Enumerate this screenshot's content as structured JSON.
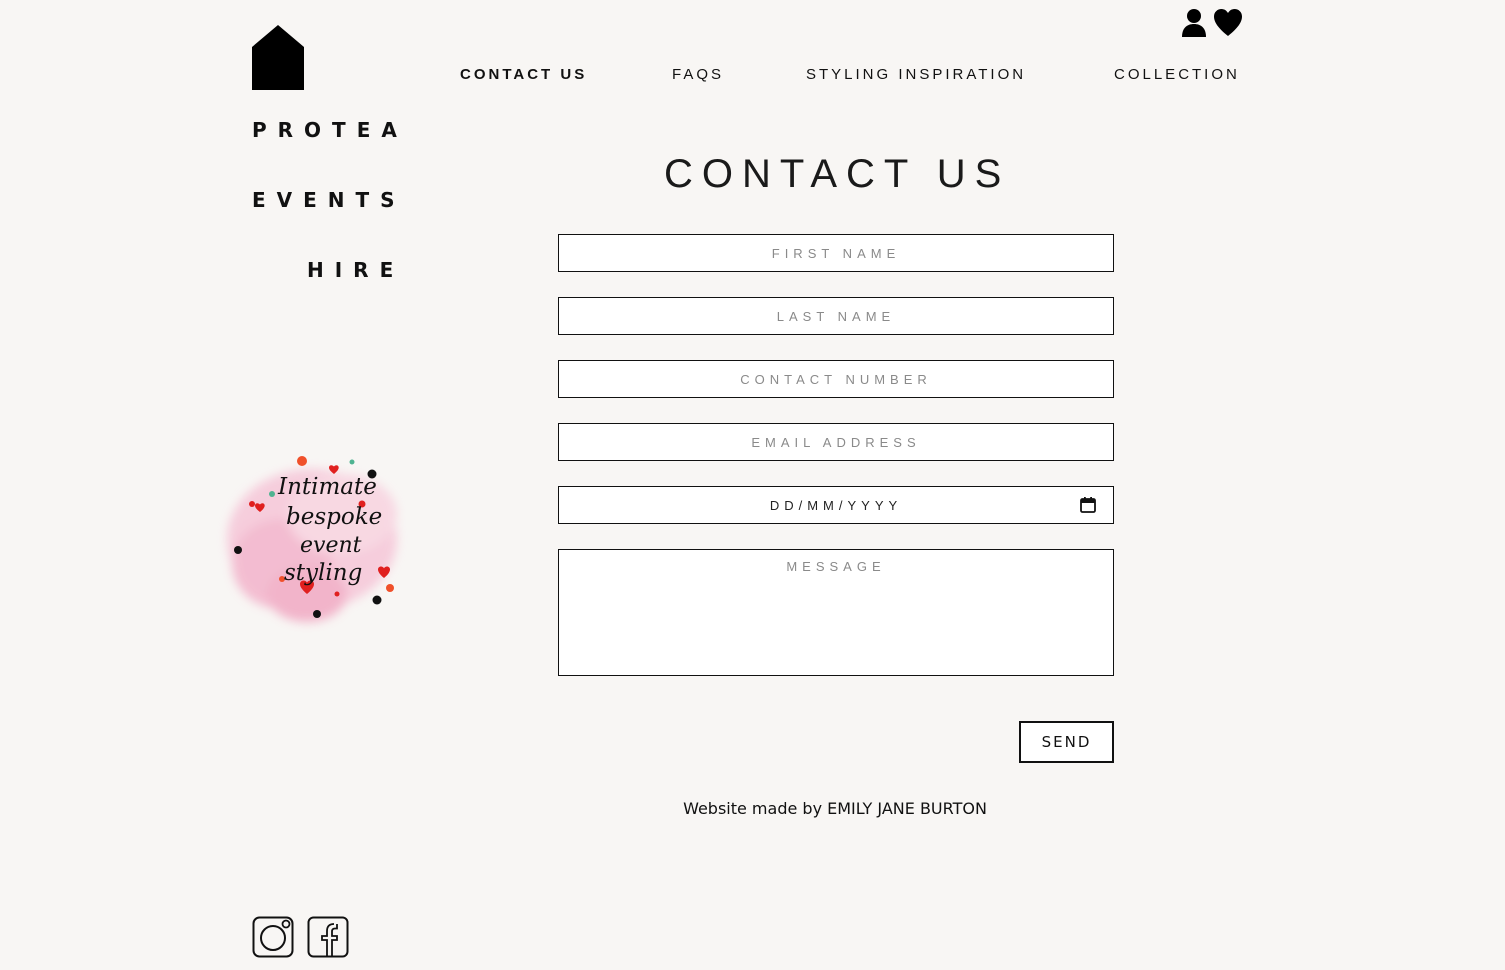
{
  "brand": {
    "lines": [
      "PROTEA",
      "EVENTS",
      "HIRE"
    ]
  },
  "nav": {
    "items": [
      {
        "label": "CONTACT US",
        "active": true
      },
      {
        "label": "FAQS",
        "active": false
      },
      {
        "label": "STYLING INSPIRATION",
        "active": false
      },
      {
        "label": "COLLECTION",
        "active": false
      }
    ]
  },
  "header_icons": [
    "user-icon",
    "heart-icon"
  ],
  "page": {
    "title": "CONTACT US"
  },
  "form": {
    "first_name_placeholder": "FIRST NAME",
    "last_name_placeholder": "LAST NAME",
    "contact_number_placeholder": "CONTACT NUMBER",
    "email_placeholder": "EMAIL ADDRESS",
    "date_placeholder": "DD/MM/YYYY",
    "message_placeholder": "MESSAGE",
    "send_label": "SEND"
  },
  "badge": {
    "lines": [
      "Intimate",
      "bespoke",
      "event",
      "styling"
    ]
  },
  "footer": {
    "credit": "Website made by EMILY JANE BURTON"
  },
  "social": [
    "instagram-icon",
    "facebook-icon"
  ],
  "colors": {
    "background": "#f8f6f4",
    "text": "#111111",
    "accent_pink": "#f2b8cf",
    "accent_red": "#e0201f"
  }
}
